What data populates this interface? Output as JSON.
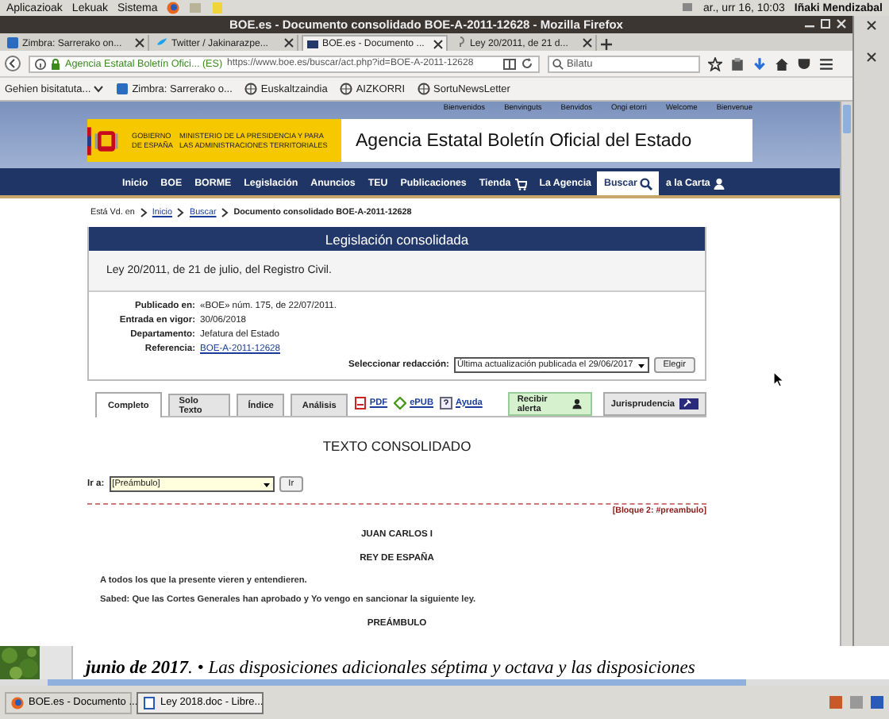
{
  "desktop_panel": {
    "menus": [
      "Aplicazioak",
      "Lekuak",
      "Sistema"
    ],
    "clock": "ar., urr 16, 10:03",
    "user": "Iñaki Mendizabal"
  },
  "window": {
    "title": "BOE.es - Documento consolidado BOE-A-2011-12628 - Mozilla Firefox"
  },
  "browser_tabs": [
    {
      "label": "Zimbra: Sarrerako on...",
      "selected": false
    },
    {
      "label": "Twitter / Jakinarazpe...",
      "selected": false
    },
    {
      "label": "BOE.es - Documento ...",
      "selected": true
    },
    {
      "label": "Ley 20/2011, de 21 d...",
      "selected": false
    }
  ],
  "address_bar": {
    "site_identity": "Agencia Estatal Boletín Ofici... (ES)",
    "url": "https://www.boe.es/buscar/act.php?id=BOE-A-2011-12628"
  },
  "search": {
    "placeholder": "Bilatu"
  },
  "bookmarks": [
    "Gehien bisitatuta...",
    "Zimbra: Sarrerako o...",
    "Euskaltzaindia",
    "AIZKORRI",
    "SortuNewsLetter"
  ],
  "page": {
    "languages": [
      "Bienvenidos",
      "Benvinguts",
      "Benvidos",
      "Ongi etorri",
      "Welcome",
      "Bienvenue"
    ],
    "logo_lines": [
      "GOBIERNO DE ESPAÑA",
      "MINISTERIO DE LA PRESIDENCIA Y PARA LAS ADMINISTRACIONES TERRITORIALES"
    ],
    "site_title": "Agencia Estatal Boletín Oficial del Estado",
    "nav": [
      {
        "label": "Inicio",
        "selected": false
      },
      {
        "label": "BOE",
        "selected": false
      },
      {
        "label": "BORME",
        "selected": false
      },
      {
        "label": "Legislación",
        "selected": false
      },
      {
        "label": "Anuncios",
        "selected": false
      },
      {
        "label": "TEU",
        "selected": false
      },
      {
        "label": "Publicaciones",
        "selected": false
      },
      {
        "label": "Tienda",
        "selected": false
      },
      {
        "label": "La Agencia",
        "selected": false
      },
      {
        "label": "Buscar",
        "selected": true
      },
      {
        "label": "a la Carta",
        "selected": false
      }
    ],
    "breadcrumb": {
      "prefix": "Está Vd. en",
      "links": [
        "Inicio",
        "Buscar"
      ],
      "current": "Documento consolidado BOE-A-2011-12628"
    },
    "card": {
      "heading": "Legislación consolidada",
      "title": "Ley 20/2011, de 21 de julio, del Registro Civil.",
      "fields": [
        {
          "label": "Publicado en:",
          "value": "«BOE» núm. 175, de 22/07/2011.",
          "kind": "text"
        },
        {
          "label": "Entrada en vigor:",
          "value": "30/06/2018",
          "kind": "text"
        },
        {
          "label": "Departamento:",
          "value": "Jefatura del Estado",
          "kind": "text"
        },
        {
          "label": "Referencia:",
          "value": "BOE-A-2011-12628",
          "kind": "link"
        }
      ],
      "version_select": {
        "label": "Seleccionar redacción:",
        "value": "Última actualización publicada el 29/06/2017",
        "button": "Elegir"
      }
    },
    "doc_tabs": [
      {
        "label": "Completo",
        "selected": true
      },
      {
        "label": "Solo Texto",
        "selected": false
      },
      {
        "label": "Índice",
        "selected": false
      },
      {
        "label": "Análisis",
        "selected": false
      }
    ],
    "links": [
      "PDF",
      "ePUB",
      "Ayuda"
    ],
    "alert_button": "Recibir alerta",
    "jurisprudence_button": "Jurisprudencia",
    "content": {
      "heading": "TEXTO CONSOLIDADO",
      "goto": {
        "label": "Ir a:",
        "value": "[Preámbulo]",
        "button": "Ir"
      },
      "block_label": "[Bloque 2: #preambulo]",
      "lines": [
        {
          "kind": "center",
          "text": "JUAN CARLOS I"
        },
        {
          "kind": "center",
          "text": "REY DE ESPAÑA"
        },
        {
          "kind": "para",
          "text": "A todos los que la presente vieren y entendieren."
        },
        {
          "kind": "para",
          "text": "Sabed: Que las Cortes Generales han aprobado y Yo vengo en sancionar la siguiente ley."
        },
        {
          "kind": "center",
          "text": "PREÁMBULO"
        }
      ]
    }
  },
  "background_document": {
    "text": "**junio de 2017**. • Las disposiciones adicionales séptima y octava y las disposiciones"
  },
  "taskbar": [
    {
      "label": "BOE.es - Documento ...",
      "selected": false
    },
    {
      "label": "Ley 2018.doc - Libre...",
      "selected": true
    }
  ]
}
